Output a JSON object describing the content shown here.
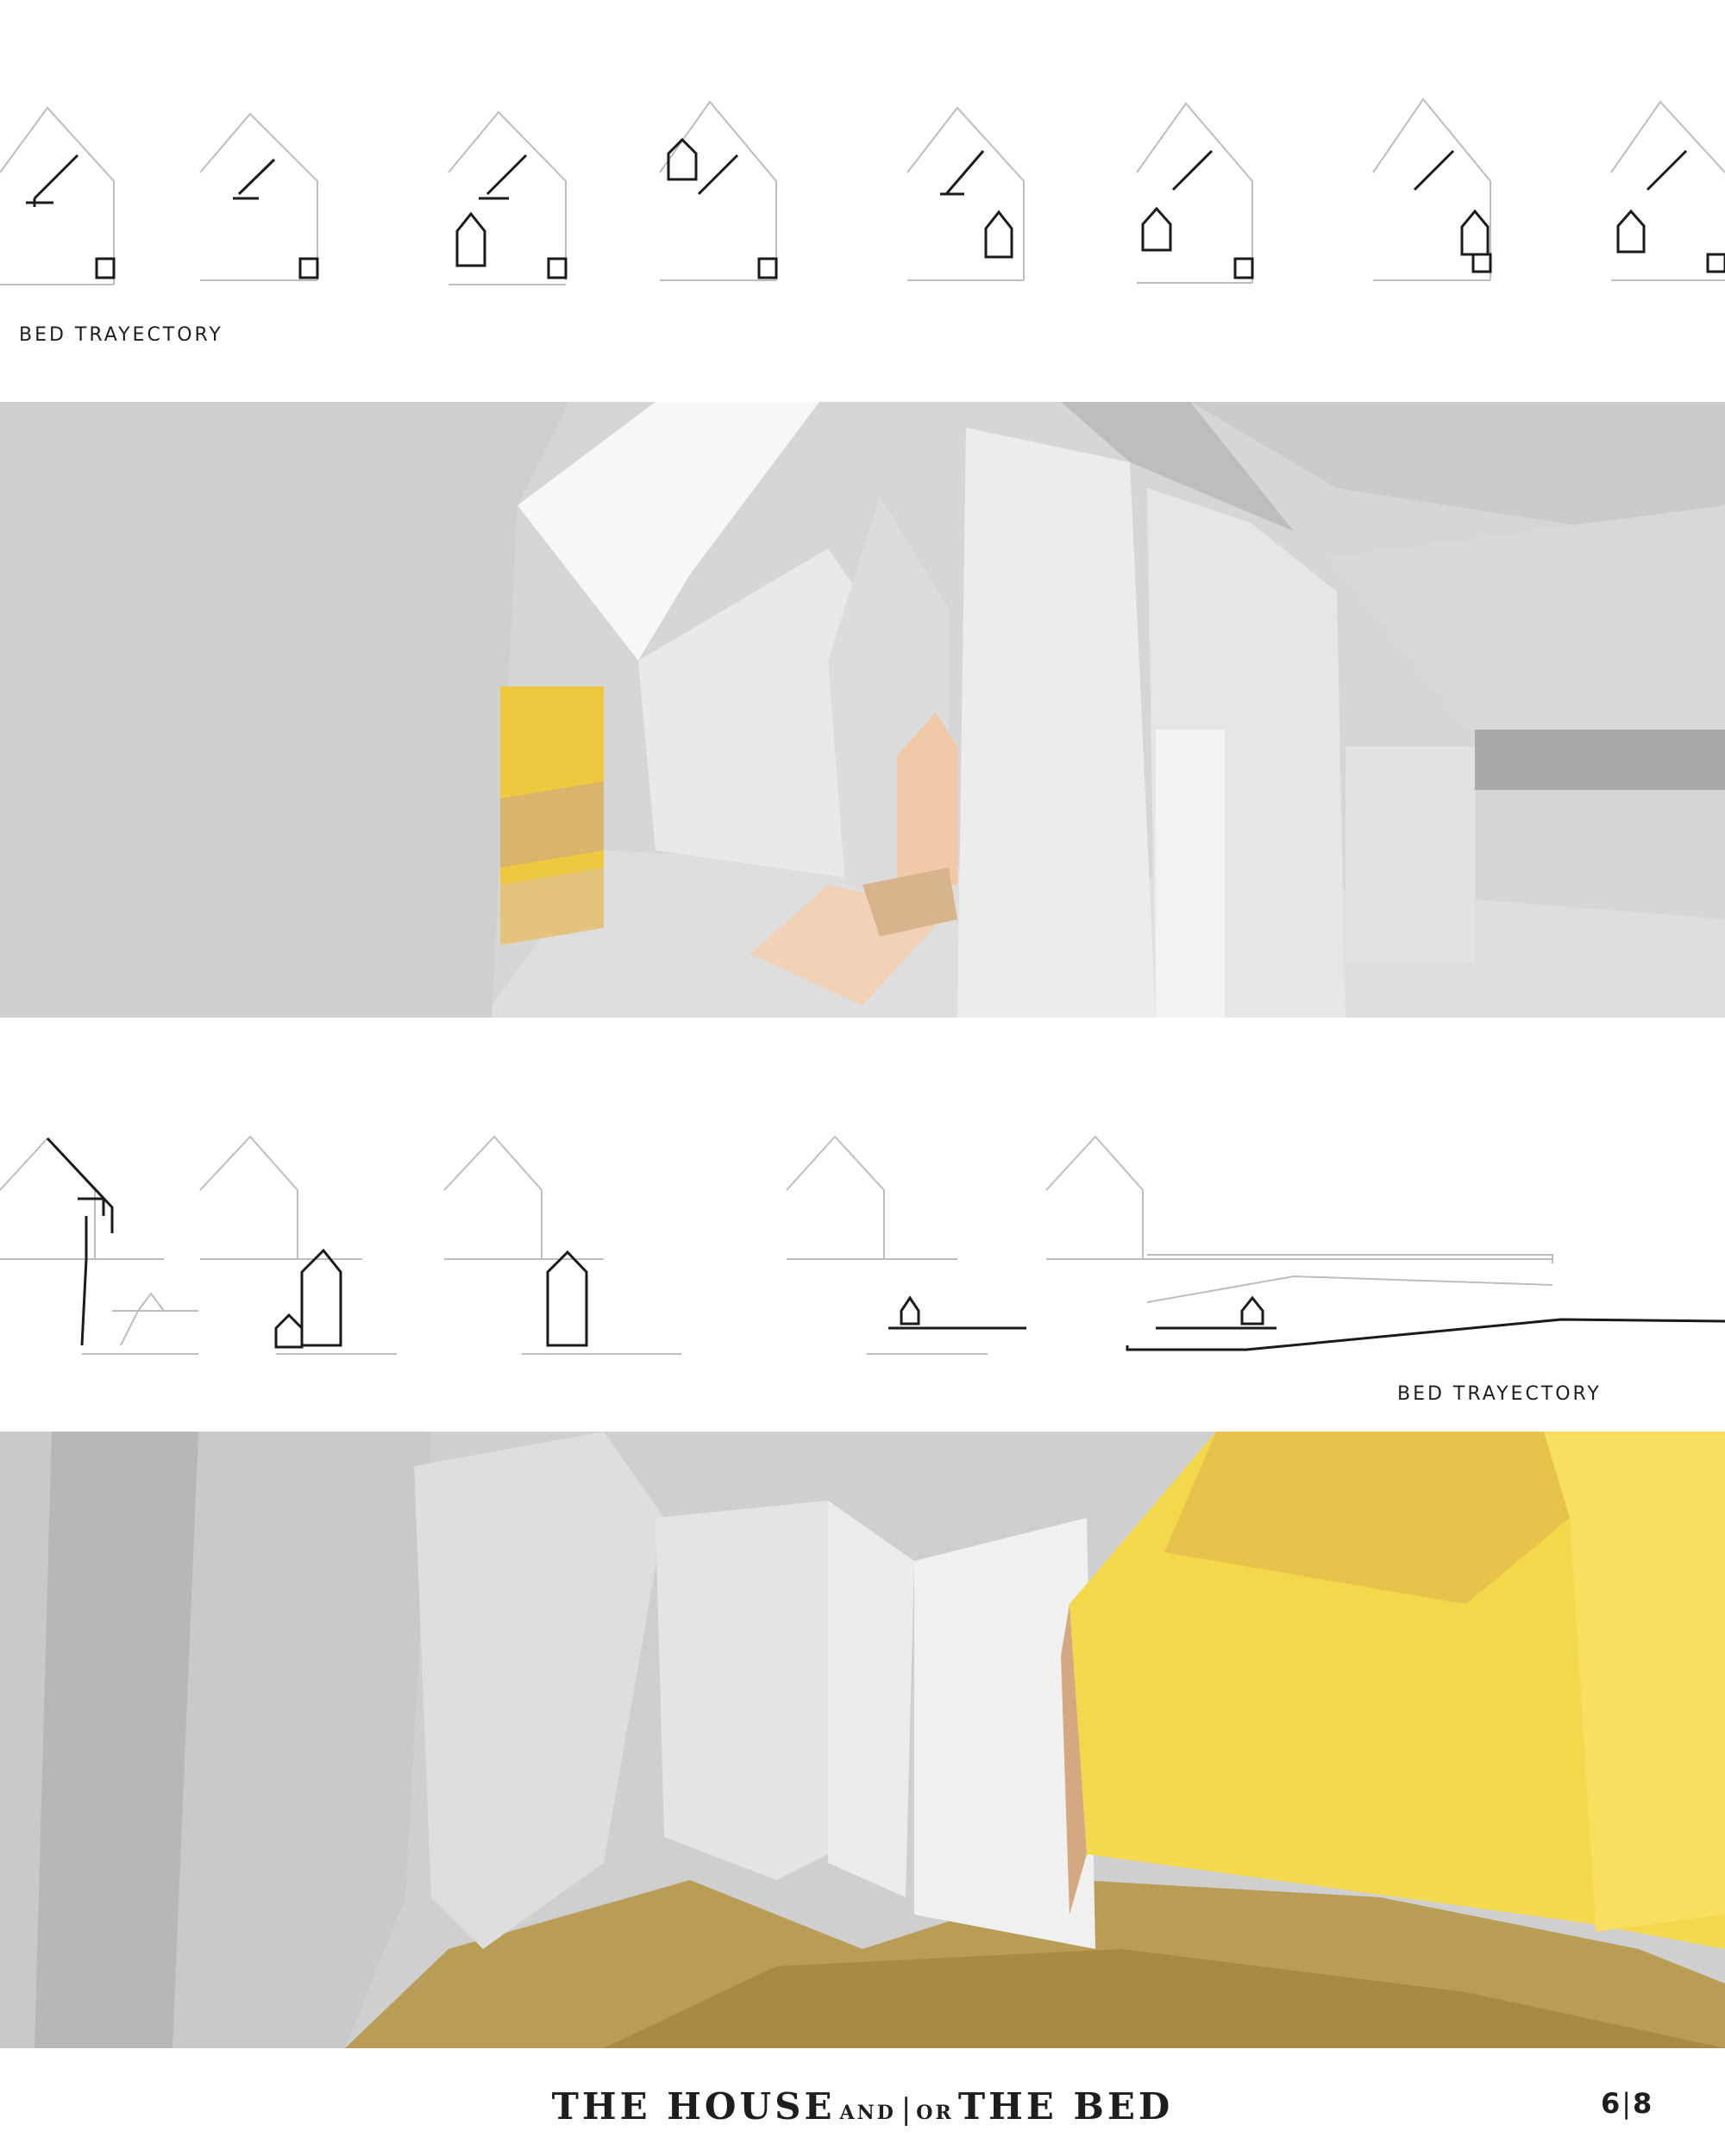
{
  "top_caption": "BED TRAYECTORY",
  "bottom_caption": "BED TRAYECTORY",
  "title": {
    "part1": "THE HOUSE",
    "part2": "AND",
    "separator": "|",
    "part3": "OR",
    "part4": "THE BED"
  },
  "page": {
    "current": "6",
    "separator": "|",
    "total": "8"
  },
  "colors": {
    "yellow": "#f2d84a",
    "floor": "#b99c55",
    "wall": "#d9d9d9",
    "wood": "#f0c9a8"
  }
}
